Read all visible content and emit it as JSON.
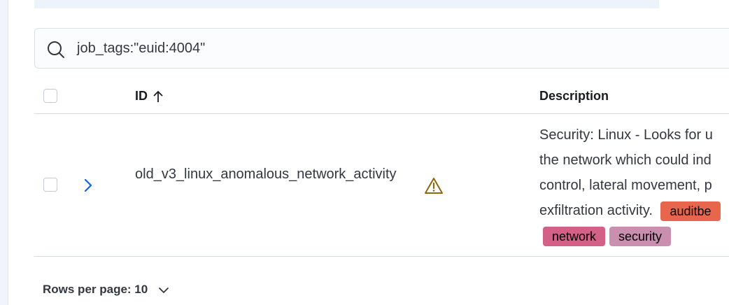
{
  "search": {
    "query": "job_tags:\"euid:4004\""
  },
  "table": {
    "columns": {
      "id": "ID",
      "description": "Description"
    },
    "rows": [
      {
        "id": "old_v3_linux_anomalous_network_activity",
        "description_lines": [
          "Security: Linux - Looks for u",
          "the network which could ind",
          "control, lateral movement, p",
          "exfiltration activity."
        ],
        "tags": [
          {
            "label": "auditbe",
            "color": "#e7664c"
          },
          {
            "label": "network",
            "color": "#d36086"
          },
          {
            "label": "security",
            "color": "#ca8eae"
          }
        ]
      }
    ]
  },
  "pagination": {
    "rows_per_page_label": "Rows per page: 10"
  },
  "colors": {
    "warning": "#8a6a0a",
    "expand": "#0b64dd",
    "border": "#d3dae6"
  }
}
